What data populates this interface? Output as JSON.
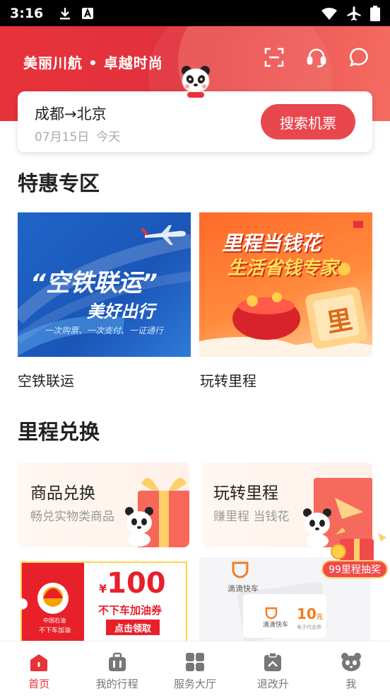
{
  "status_bar": {
    "time": "3:16"
  },
  "header": {
    "slogan": "美丽川航 • 卓越时尚"
  },
  "search": {
    "route": "成都→北京",
    "date": "07月15日",
    "day": "今天",
    "button_label": "搜索机票"
  },
  "specials": {
    "title": "特惠专区",
    "cards": [
      {
        "caption": "空铁联运",
        "banner_main": "“空铁联运”",
        "banner_sub": "美好出行",
        "banner_note": "一次购票、一次支付、一证通行"
      },
      {
        "caption": "玩转里程",
        "banner_line1": "里程当钱花",
        "banner_line2": "生活省钱专家",
        "banner_badge": "里"
      }
    ]
  },
  "exchange": {
    "title": "里程兑换",
    "cards": [
      {
        "title": "商品兑换",
        "subtitle": "畅兑实物类商品"
      },
      {
        "title": "玩转里程",
        "subtitle": "赚里程 当钱花"
      }
    ],
    "lottery_label": "99里程抽奖"
  },
  "coupons": {
    "fuel": {
      "currency": "¥",
      "amount": "100",
      "name": "不下车加油券",
      "button": "点击领取",
      "brand": "中国石油",
      "brand_sub": "不下车加油"
    },
    "didi": {
      "brand": "滴滴快车",
      "ticket_brand": "滴滴快车",
      "ticket_value": "10",
      "ticket_unit": "元",
      "ticket_note": "电子代金券"
    }
  },
  "tabs": [
    {
      "label": "首页",
      "active": true
    },
    {
      "label": "我的行程",
      "active": false
    },
    {
      "label": "服务大厅",
      "active": false
    },
    {
      "label": "退改升",
      "active": false
    },
    {
      "label": "我",
      "active": false
    }
  ],
  "colors": {
    "brand_red": "#e8323a",
    "search_button": "#e8474e"
  }
}
